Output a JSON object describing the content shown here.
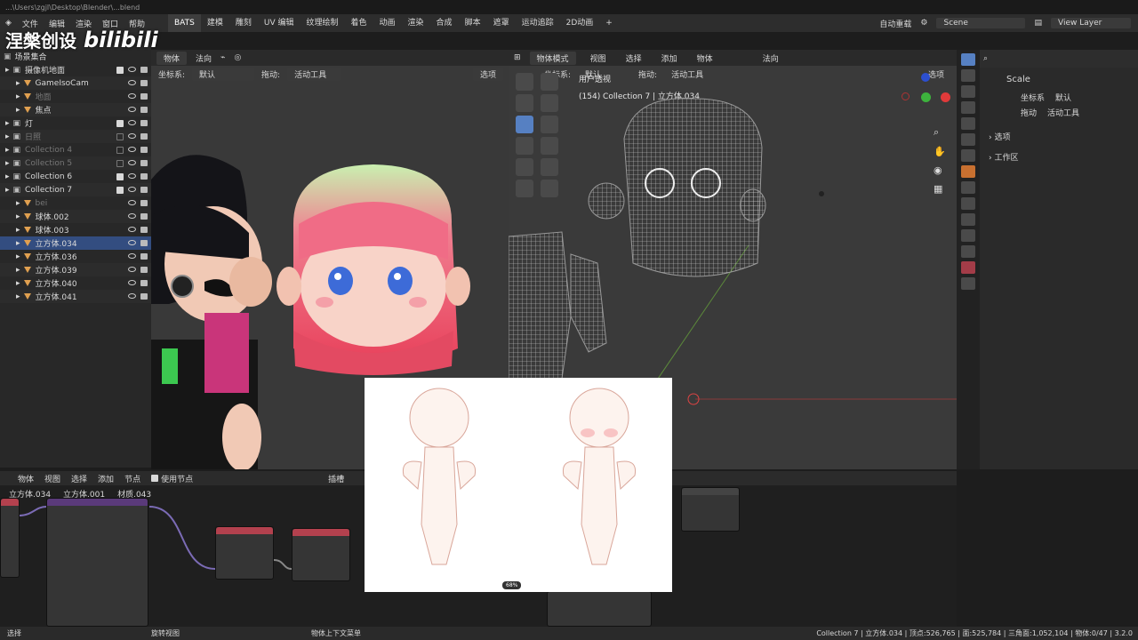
{
  "window": {
    "title_path": "...\\Users\\zgjl\\Desktop\\Blender\\...blend"
  },
  "menu": {
    "items": [
      "文件",
      "编辑",
      "渲染",
      "窗口",
      "帮助"
    ]
  },
  "workspaces": [
    "BATS",
    "建模",
    "雕刻",
    "UV 编辑",
    "纹理绘制",
    "着色",
    "动画",
    "渲染",
    "合成",
    "脚本",
    "遮罩",
    "运动追踪",
    "2D动画"
  ],
  "top_right": {
    "auto_key": "自动重载",
    "scene": "Scene",
    "view_layer": "View Layer"
  },
  "watermark": {
    "text": "涅槃创设",
    "brand": "bilibili"
  },
  "outliner": {
    "title": "场景集合",
    "rows": [
      {
        "label": "摄像机地面",
        "indent": 0,
        "checked": true
      },
      {
        "label": "GameIsoCam",
        "indent": 1,
        "checked": false
      },
      {
        "label": "地面",
        "indent": 1,
        "checked": false,
        "dim": true
      },
      {
        "label": "焦点",
        "indent": 1,
        "checked": false
      },
      {
        "label": "灯",
        "indent": 0,
        "checked": true
      },
      {
        "label": "日照",
        "indent": 0,
        "checked": false,
        "dim": true
      },
      {
        "label": "Collection 4",
        "indent": 0,
        "checked": false,
        "dim": true
      },
      {
        "label": "Collection 5",
        "indent": 0,
        "checked": false,
        "dim": true
      },
      {
        "label": "Collection 6",
        "indent": 0,
        "checked": true
      },
      {
        "label": "Collection 7",
        "indent": 0,
        "checked": true
      },
      {
        "label": "bei",
        "indent": 1,
        "checked": false,
        "dim": true
      },
      {
        "label": "球体.002",
        "indent": 1,
        "checked": false
      },
      {
        "label": "球体.003",
        "indent": 1,
        "checked": false
      },
      {
        "label": "立方体.034",
        "indent": 1,
        "checked": false,
        "selected": true
      },
      {
        "label": "立方体.036",
        "indent": 1,
        "checked": false
      },
      {
        "label": "立方体.039",
        "indent": 1,
        "checked": false
      },
      {
        "label": "立方体.040",
        "indent": 1,
        "checked": false
      },
      {
        "label": "立方体.041",
        "indent": 1,
        "checked": false
      }
    ]
  },
  "left_viewport": {
    "mode": "物体",
    "coord_label": "坐标系:",
    "coord_value": "默认",
    "drag_label": "拖动:",
    "drag_value": "活动工具",
    "orient": "法向",
    "options": "选项"
  },
  "right_viewport": {
    "mode": "物体模式",
    "menus": [
      "视图",
      "选择",
      "添加",
      "物体"
    ],
    "orient": "法向",
    "coord_label": "坐标系:",
    "coord_value": "默认",
    "drag_label": "拖动:",
    "drag_value": "活动工具",
    "options": "选项",
    "view_name": "用户透视",
    "view_sub": "(154) Collection 7 | 立方体.034"
  },
  "properties": {
    "tool_name": "Scale",
    "coord_label": "坐标系",
    "coord_value": "默认",
    "drag_label": "拖动",
    "drag_value": "活动工具",
    "sections": [
      "选项",
      "工作区"
    ]
  },
  "node_editor": {
    "mode": "物体",
    "menus": [
      "视图",
      "选择",
      "添加",
      "节点"
    ],
    "use_nodes": "使用节点",
    "slot_label": "插槽",
    "breadcrumb": [
      "立方体.034",
      "立方体.001",
      "材质.043"
    ],
    "zoom_badge": "68%"
  },
  "statusbar": {
    "left": "选择",
    "middle": "旋转视图",
    "right_ctx": "物体上下文菜单",
    "stats": "Collection 7 | 立方体.034 | 顶点:526,765 | 面:525,784 | 三角面:1,052,104 | 物体:0/47 | 3.2.0"
  },
  "colors": {
    "accent": "#5680c2",
    "selected_row": "#334d80",
    "node_header_red": "#b3414e"
  }
}
